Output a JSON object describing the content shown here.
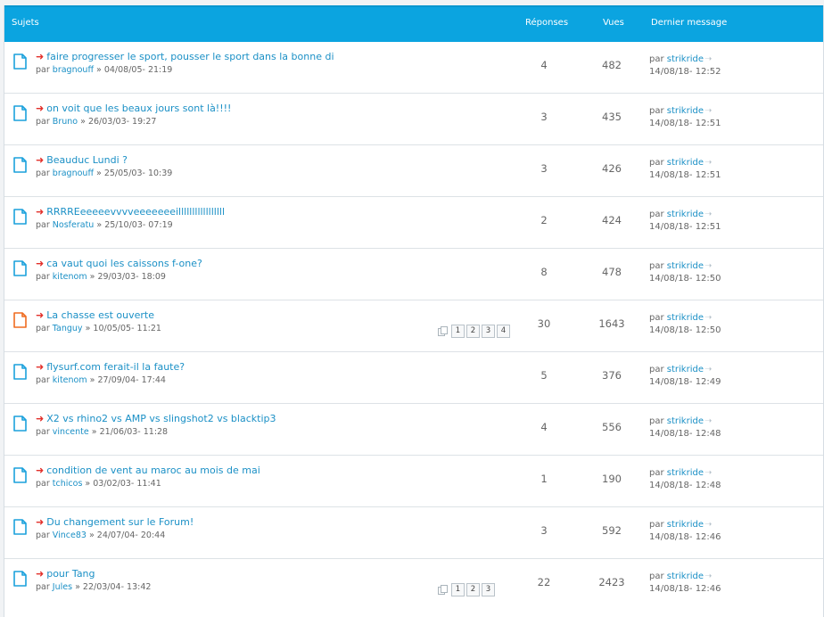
{
  "header": {
    "subjects": "Sujets",
    "replies": "Réponses",
    "views": "Vues",
    "last_post": "Dernier message"
  },
  "colors": {
    "header_bg": "#0ba4e0",
    "link": "#1b90c6",
    "arrow": "#e2302a",
    "icon_normal": "#1ba1dc",
    "icon_hot": "#ef6c21"
  },
  "topics": [
    {
      "title": "faire progresser le sport, pousser le sport dans la bonne di",
      "by": "par",
      "author": "bragnouff",
      "date": "» 04/08/05- 21:19",
      "replies": "4",
      "views": "482",
      "last_by_prefix": "par",
      "last_by": "strikride",
      "last_date": "14/08/18- 12:52",
      "icon": "document-icon"
    },
    {
      "title": "on voit que les beaux jours sont là!!!!",
      "by": "par",
      "author": "Bruno",
      "date": "» 26/03/03- 19:27",
      "replies": "3",
      "views": "435",
      "last_by_prefix": "par",
      "last_by": "strikride",
      "last_date": "14/08/18- 12:51",
      "icon": "document-icon"
    },
    {
      "title": "Beauduc Lundi ?",
      "by": "par",
      "author": "bragnouff",
      "date": "» 25/05/03- 10:39",
      "replies": "3",
      "views": "426",
      "last_by_prefix": "par",
      "last_by": "strikride",
      "last_date": "14/08/18- 12:51",
      "icon": "document-icon"
    },
    {
      "title": "RRRREeeeeevvvveeeeeeeilllllllllllllllll",
      "by": "par",
      "author": "Nosferatu",
      "date": "» 25/10/03- 07:19",
      "replies": "2",
      "views": "424",
      "last_by_prefix": "par",
      "last_by": "strikride",
      "last_date": "14/08/18- 12:51",
      "icon": "document-icon"
    },
    {
      "title": "ca vaut quoi les caissons f-one?",
      "by": "par",
      "author": "kitenom",
      "date": "» 29/03/03- 18:09",
      "replies": "8",
      "views": "478",
      "last_by_prefix": "par",
      "last_by": "strikride",
      "last_date": "14/08/18- 12:50",
      "icon": "document-icon"
    },
    {
      "title": "La chasse est ouverte",
      "by": "par",
      "author": "Tanguy",
      "date": "» 10/05/05- 11:21",
      "replies": "30",
      "views": "1643",
      "last_by_prefix": "par",
      "last_by": "strikride",
      "last_date": "14/08/18- 12:50",
      "icon": "hot-document-icon",
      "pages": [
        "1",
        "2",
        "3",
        "4"
      ]
    },
    {
      "title": "flysurf.com ferait-il la faute?",
      "by": "par",
      "author": "kitenom",
      "date": "» 27/09/04- 17:44",
      "replies": "5",
      "views": "376",
      "last_by_prefix": "par",
      "last_by": "strikride",
      "last_date": "14/08/18- 12:49",
      "icon": "document-icon"
    },
    {
      "title": "X2 vs rhino2 vs AMP vs slingshot2 vs blacktip3",
      "by": "par",
      "author": "vincente",
      "date": "» 21/06/03- 11:28",
      "replies": "4",
      "views": "556",
      "last_by_prefix": "par",
      "last_by": "strikride",
      "last_date": "14/08/18- 12:48",
      "icon": "document-icon"
    },
    {
      "title": "condition de vent au maroc au mois de mai",
      "by": "par",
      "author": "tchicos",
      "date": "» 03/02/03- 11:41",
      "replies": "1",
      "views": "190",
      "last_by_prefix": "par",
      "last_by": "strikride",
      "last_date": "14/08/18- 12:48",
      "icon": "document-icon"
    },
    {
      "title": "Du changement sur le Forum!",
      "by": "par",
      "author": "Vince83",
      "date": "» 24/07/04- 20:44",
      "replies": "3",
      "views": "592",
      "last_by_prefix": "par",
      "last_by": "strikride",
      "last_date": "14/08/18- 12:46",
      "icon": "document-icon"
    },
    {
      "title": "pour Tang",
      "by": "par",
      "author": "Jules",
      "date": "» 22/03/04- 13:42",
      "replies": "22",
      "views": "2423",
      "last_by_prefix": "par",
      "last_by": "strikride",
      "last_date": "14/08/18- 12:46",
      "icon": "document-icon",
      "pages": [
        "1",
        "2",
        "3"
      ]
    }
  ]
}
